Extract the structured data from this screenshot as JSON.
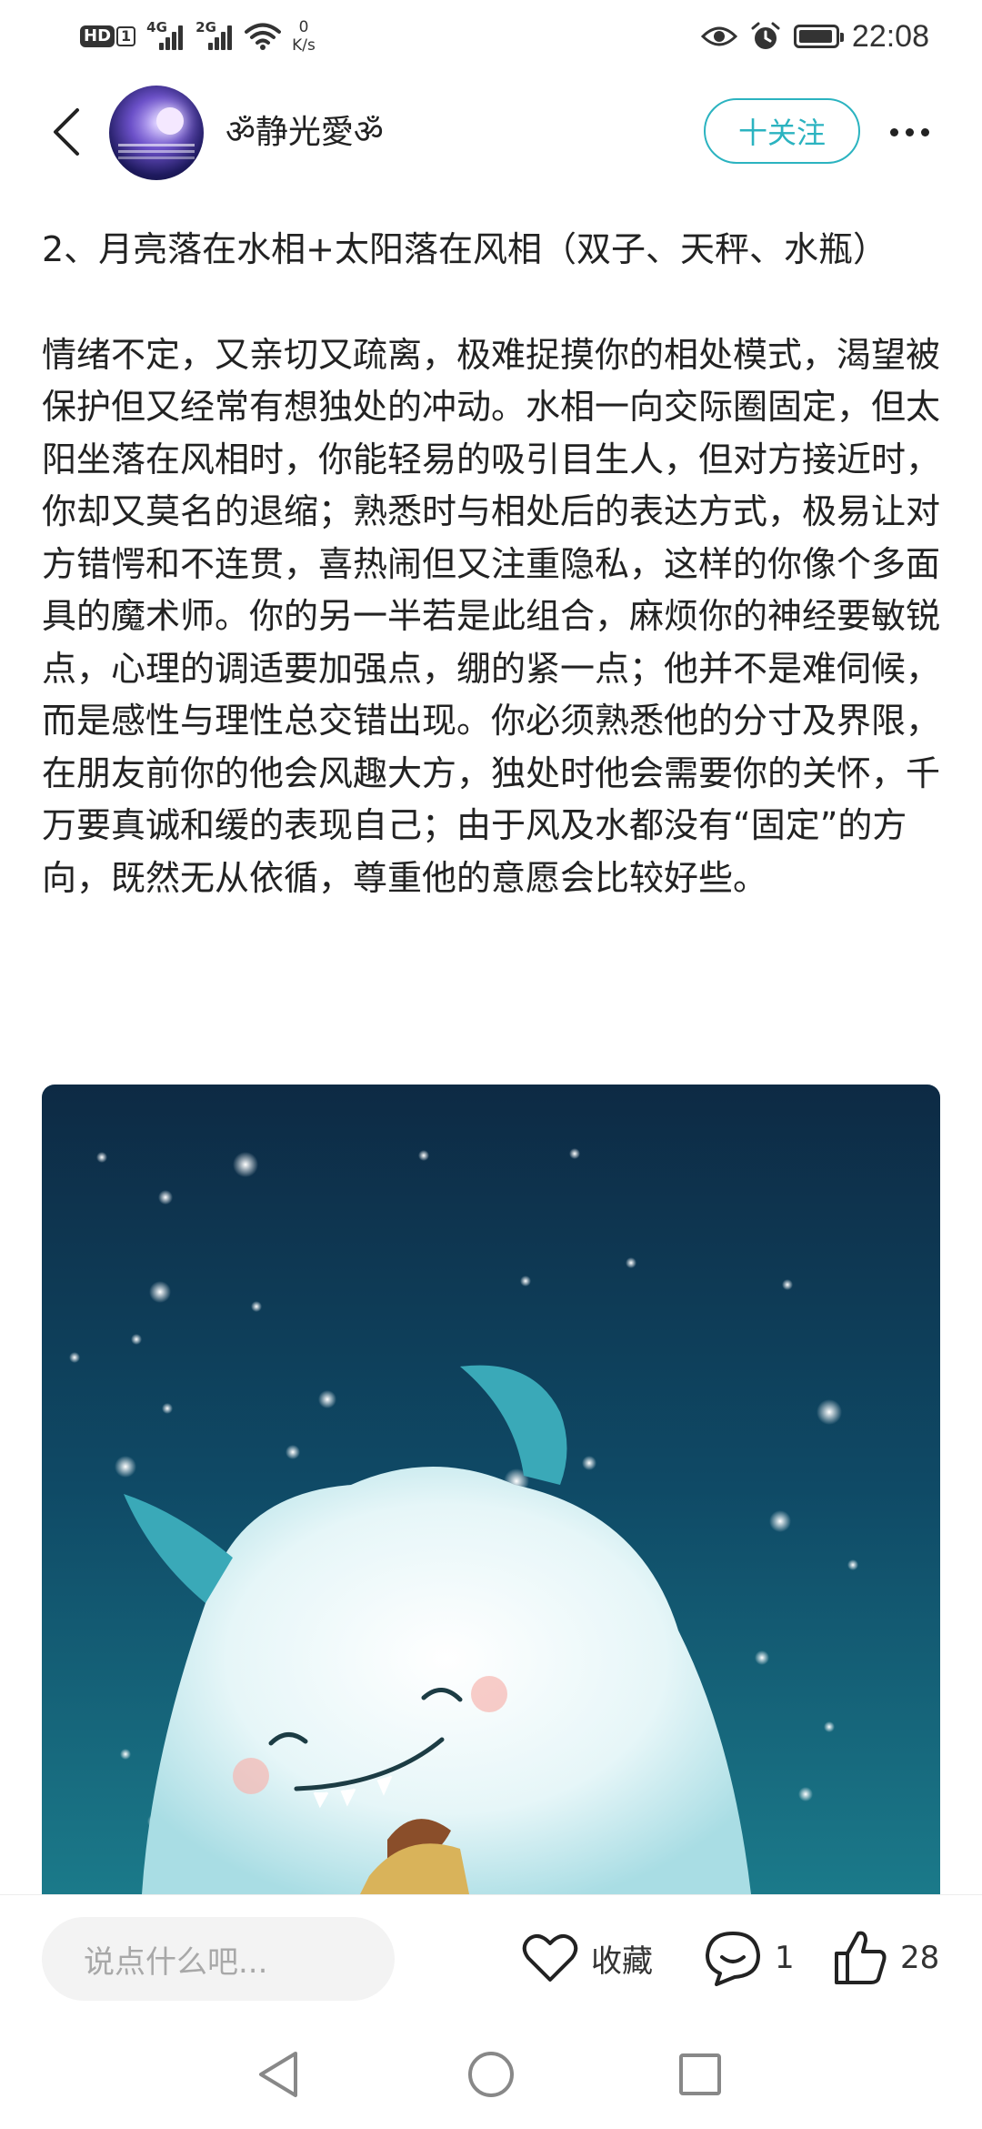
{
  "status_bar": {
    "hd_label": "HD",
    "sim_number": "1",
    "signal1_tag": "4G",
    "signal2_tag": "2G",
    "net_speed_value": "0",
    "net_speed_unit": "K/s",
    "time": "22:08",
    "icons": [
      "hd-icon",
      "signal-4g-icon",
      "signal-2g-icon",
      "wifi-icon",
      "eye-icon",
      "alarm-icon",
      "battery-icon"
    ]
  },
  "header": {
    "username": "ॐ静光愛ॐ",
    "follow_label": "十关注",
    "accent_color": "#2bb3c0"
  },
  "article": {
    "heading": "2、月亮落在水相+太阳落在风相（双子、天秤、水瓶）",
    "body": "情绪不定，又亲切又疏离，极难捉摸你的相处模式，渴望被保护但又经常有想独处的冲动。水相一向交际圈固定，但太阳坐落在风相时，你能轻易的吸引目生人，但对方接近时，你却又莫名的退缩；熟悉时与相处后的表达方式，极易让对方错愕和不连贯，喜热闹但又注重隐私，这样的你像个多面具的魔术师。你的另一半若是此组合，麻烦你的神经要敏锐点，心理的调适要加强点，绷的紧一点；他并不是难伺候，而是感性与理性总交错出现。你必须熟悉他的分寸及界限，在朋友前你的他会风趣大方，独处时他会需要你的关怀，千万要真诚和缓的表现自己；由于风及水都没有“固定”的方向，既然无从依循，尊重他的意愿会比较好些。"
  },
  "image": {
    "subject": "white furry monster under starry teal sky"
  },
  "action_bar": {
    "comment_placeholder": "说点什么吧...",
    "favorite_label": "收藏",
    "comment_count": "1",
    "like_count": "28"
  },
  "nav_bar": {
    "buttons": [
      "back-triangle-icon",
      "home-circle-icon",
      "recents-square-icon"
    ]
  }
}
